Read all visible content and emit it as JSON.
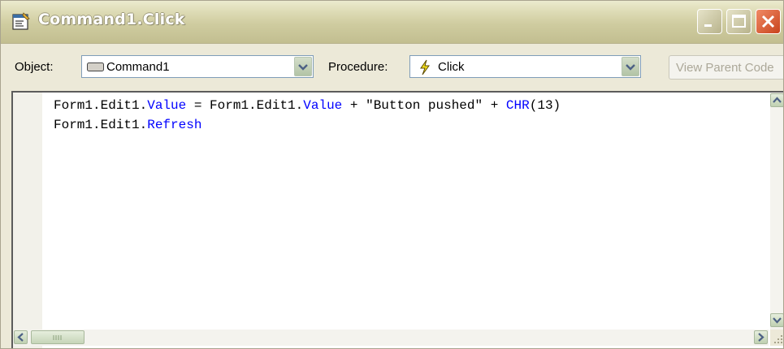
{
  "window": {
    "title": "Command1.Click"
  },
  "toolbar": {
    "object_label": "Object:",
    "object_value": "Command1",
    "procedure_label": "Procedure:",
    "procedure_value": "Click",
    "view_parent_code_label": "View Parent Code"
  },
  "editor": {
    "lines": [
      [
        {
          "t": "Form1.Edit1.",
          "kw": false
        },
        {
          "t": "Value",
          "kw": true
        },
        {
          "t": " = Form1.Edit1.",
          "kw": false
        },
        {
          "t": "Value",
          "kw": true
        },
        {
          "t": " + \"Button pushed\" + ",
          "kw": false
        },
        {
          "t": "CHR",
          "kw": true
        },
        {
          "t": "(13)",
          "kw": false
        }
      ],
      [
        {
          "t": "Form1.Edit1.",
          "kw": false
        },
        {
          "t": "Refresh",
          "kw": true
        }
      ]
    ]
  },
  "colors": {
    "keyword": "#0000ff",
    "close_button": "#d3522d",
    "titlebar": "#cfcca0"
  },
  "icons": {
    "title": "form-code-icon",
    "object": "command-button-icon",
    "procedure": "lightning-bolt-icon"
  }
}
